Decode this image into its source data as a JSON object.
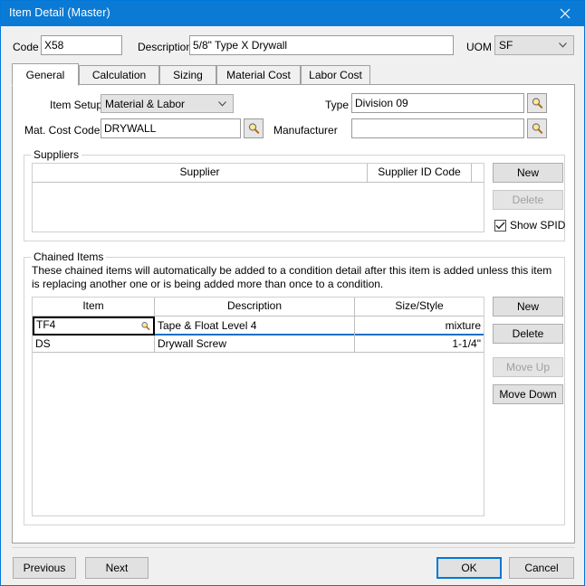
{
  "window": {
    "title": "Item Detail (Master)",
    "close_icon": "close-icon",
    "accent_color": "#0b7ad4"
  },
  "header": {
    "code_label": "Code",
    "code_value": "X58",
    "description_label": "Description",
    "description_value": "5/8\" Type X Drywall",
    "uom_label": "UOM",
    "uom_value": "SF"
  },
  "tabs": [
    {
      "label": "General",
      "active": true
    },
    {
      "label": "Calculation",
      "active": false
    },
    {
      "label": "Sizing",
      "active": false
    },
    {
      "label": "Material Cost",
      "active": false
    },
    {
      "label": "Labor Cost",
      "active": false
    }
  ],
  "general": {
    "item_setup_label": "Item Setup",
    "item_setup_value": "Material & Labor",
    "mat_cost_code_label": "Mat. Cost Code",
    "mat_cost_code_value": "DRYWALL",
    "mat_cost_code_browse_icon": "search-icon",
    "type_label": "Type",
    "type_value": "Division 09",
    "type_browse_icon": "search-icon",
    "manufacturer_label": "Manufacturer",
    "manufacturer_value": "",
    "manufacturer_browse_icon": "search-icon"
  },
  "suppliers": {
    "group_title": "Suppliers",
    "columns": [
      "Supplier",
      "Supplier ID Code"
    ],
    "rows": [],
    "new_label": "New",
    "delete_label": "Delete",
    "delete_disabled": true,
    "show_spid_label": "Show SPID",
    "show_spid_checked": true
  },
  "chained_items": {
    "group_title": "Chained Items",
    "description": "These chained items will automatically be added to a condition detail after this item is added unless this item is replacing another one or is being added more than once to a condition.",
    "columns": [
      "Item",
      "Description",
      "Size/Style"
    ],
    "rows": [
      {
        "item": "TF4",
        "description": "Tape & Float Level 4",
        "size_style": "mixture",
        "selected": true,
        "item_browse_icon": "search-icon"
      },
      {
        "item": "DS",
        "description": "Drywall Screw",
        "size_style": "1-1/4\"",
        "selected": false
      }
    ],
    "new_label": "New",
    "delete_label": "Delete",
    "move_up_label": "Move Up",
    "move_up_disabled": true,
    "move_down_label": "Move Down",
    "move_down_disabled": false
  },
  "footer": {
    "previous_label": "Previous",
    "next_label": "Next",
    "ok_label": "OK",
    "cancel_label": "Cancel"
  }
}
